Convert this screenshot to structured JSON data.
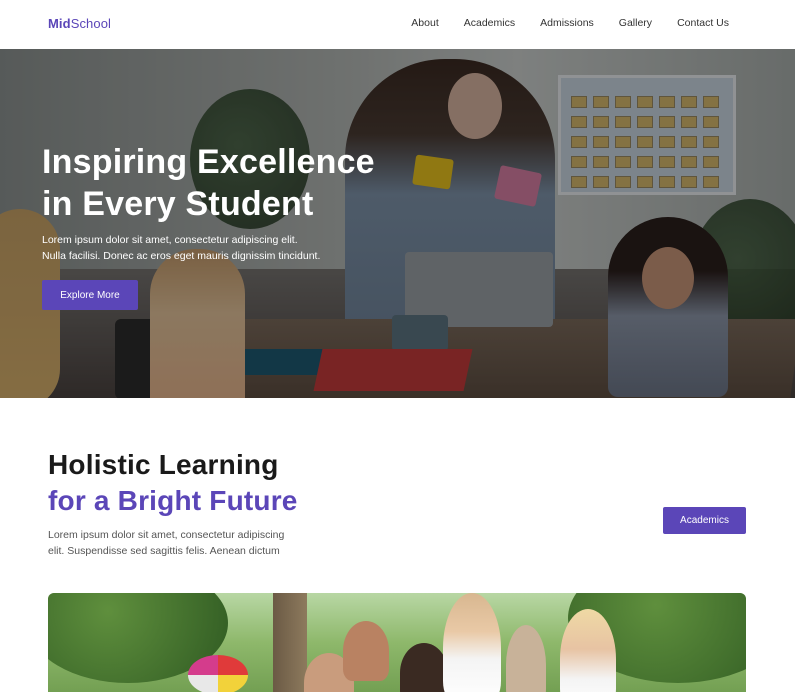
{
  "header": {
    "logo_bold": "Mid",
    "logo_regular": "School",
    "nav": [
      {
        "label": "About"
      },
      {
        "label": "Academics"
      },
      {
        "label": "Admissions"
      },
      {
        "label": "Gallery"
      },
      {
        "label": "Contact Us"
      }
    ]
  },
  "hero": {
    "title_line1": "Inspiring Excellence",
    "title_line2": "in Every Student",
    "subtitle_line1": "Lorem ipsum dolor sit amet, consectetur adipiscing elit.",
    "subtitle_line2": "Nulla facilisi. Donec ac eros eget mauris dignissim tincidunt.",
    "button_label": "Explore More"
  },
  "section": {
    "title_line1": "Holistic Learning",
    "title_line2": "for a Bright Future",
    "text_line1": "Lorem ipsum dolor sit amet, consectetur adipiscing",
    "text_line2": "elit. Suspendisse sed sagittis felis. Aenean dictum",
    "button_label": "Academics"
  },
  "colors": {
    "accent": "#5b46b8",
    "text_dark": "#1a1a1a",
    "text_muted": "#555555"
  }
}
